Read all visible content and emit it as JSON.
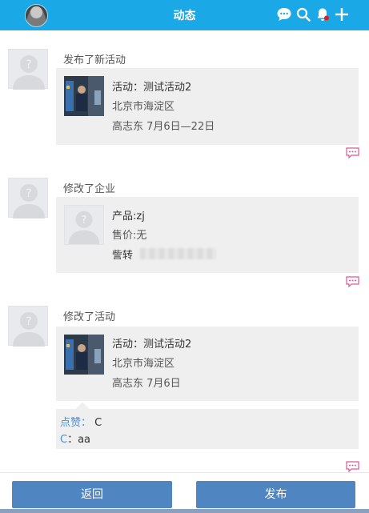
{
  "header": {
    "title": "动态"
  },
  "feed": [
    {
      "action": "发布了新活动",
      "lines": [
        "活动：测试活动2",
        "北京市海淀区",
        "高志东  7月6日—22日"
      ]
    },
    {
      "action": "修改了企业",
      "lines": [
        "产品:zj",
        "售价:无",
        "訾转"
      ]
    },
    {
      "action": "修改了活动",
      "lines": [
        "活动：测试活动2",
        "北京市海淀区",
        "高志东  7月6日"
      ],
      "likes": {
        "label": "点赞：",
        "names": "C"
      },
      "comment": {
        "author": "C",
        "sep": "：",
        "text": "aa"
      }
    }
  ],
  "footer": {
    "back_label": "返回",
    "publish_label": "发布"
  },
  "icons": [
    "chat-icon",
    "search-icon",
    "bell-icon",
    "plus-icon",
    "comment-icon"
  ],
  "colors": {
    "header_bg": "#1aa8e6",
    "button_bg": "#4f86c2",
    "link_blue": "#4a8fd9",
    "badge_red": "#e02020",
    "comment_pink": "#e0569a"
  }
}
